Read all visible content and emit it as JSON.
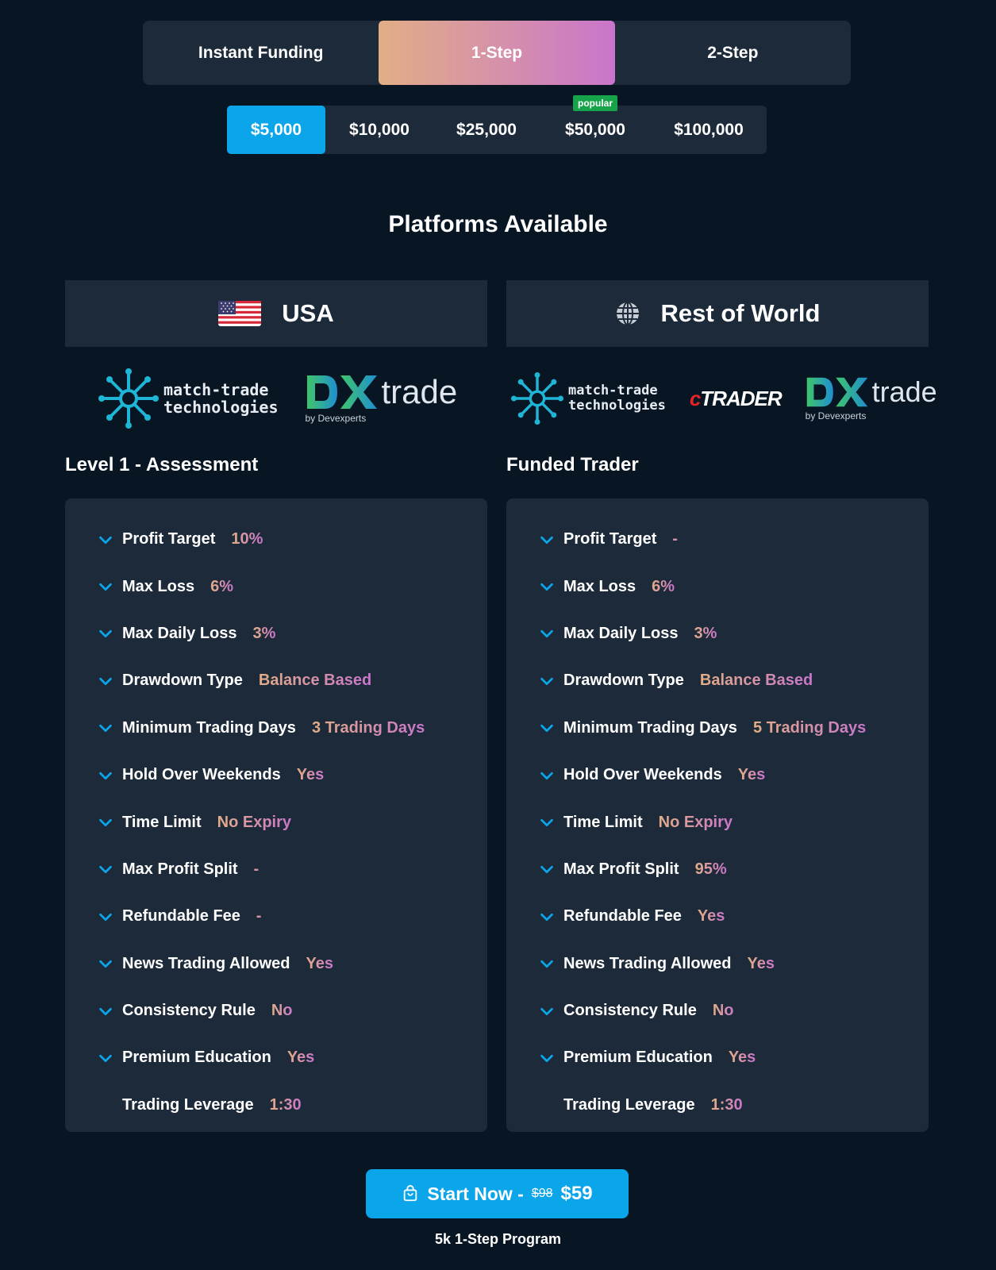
{
  "step_tabs": [
    "Instant Funding",
    "1-Step",
    "2-Step"
  ],
  "active_step": 1,
  "amount_tabs": [
    "$5,000",
    "$10,000",
    "$25,000",
    "$50,000",
    "$100,000"
  ],
  "active_amount": 0,
  "popular_badge": "popular",
  "platforms_title": "Platforms Available",
  "regions": {
    "usa": {
      "label": "USA",
      "icon": "us-flag-icon"
    },
    "row": {
      "label": "Rest of World",
      "icon": "globe-icon"
    }
  },
  "logos": {
    "match_trade_line1": "match-trade",
    "match_trade_line2": "technologies",
    "dx_trade": "trade",
    "dx_by": "by Devexperts",
    "ctrader_c": "c",
    "ctrader_rest": "TRADER"
  },
  "levels": {
    "left": {
      "title": "Level 1 - Assessment",
      "rules": [
        {
          "label": "Profit Target",
          "value": "10%"
        },
        {
          "label": "Max Loss",
          "value": "6%"
        },
        {
          "label": "Max Daily Loss",
          "value": "3%"
        },
        {
          "label": "Drawdown Type",
          "value": "Balance Based"
        },
        {
          "label": "Minimum Trading Days",
          "value": "3 Trading Days"
        },
        {
          "label": "Hold Over Weekends",
          "value": "Yes"
        },
        {
          "label": "Time Limit",
          "value": "No Expiry"
        },
        {
          "label": "Max Profit Split",
          "value": "-"
        },
        {
          "label": "Refundable Fee",
          "value": "-"
        },
        {
          "label": "News Trading Allowed",
          "value": "Yes"
        },
        {
          "label": "Consistency Rule",
          "value": "No"
        },
        {
          "label": "Premium Education",
          "value": "Yes"
        },
        {
          "label": "Trading Leverage",
          "value": "1:30"
        }
      ]
    },
    "right": {
      "title": "Funded Trader",
      "rules": [
        {
          "label": "Profit Target",
          "value": "-"
        },
        {
          "label": "Max Loss",
          "value": "6%"
        },
        {
          "label": "Max Daily Loss",
          "value": "3%"
        },
        {
          "label": "Drawdown Type",
          "value": "Balance Based"
        },
        {
          "label": "Minimum Trading Days",
          "value": "5 Trading Days"
        },
        {
          "label": "Hold Over Weekends",
          "value": "Yes"
        },
        {
          "label": "Time Limit",
          "value": "No Expiry"
        },
        {
          "label": "Max Profit Split",
          "value": "95%"
        },
        {
          "label": "Refundable Fee",
          "value": "Yes"
        },
        {
          "label": "News Trading Allowed",
          "value": "Yes"
        },
        {
          "label": "Consistency Rule",
          "value": "No"
        },
        {
          "label": "Premium Education",
          "value": "Yes"
        },
        {
          "label": "Trading Leverage",
          "value": "1:30"
        }
      ]
    }
  },
  "cta": {
    "label": "Start Now -",
    "old_price": "$98",
    "price": "$59",
    "icon": "shopping-bag-icon",
    "subtitle": "5k 1-Step Program"
  },
  "colors": {
    "background": "#081523",
    "panel": "#1d2a3a",
    "accent_blue": "#0ba5ea",
    "gradient_start": "#e2ae86",
    "gradient_end": "#c975cb",
    "popular_green": "#16a34a"
  }
}
